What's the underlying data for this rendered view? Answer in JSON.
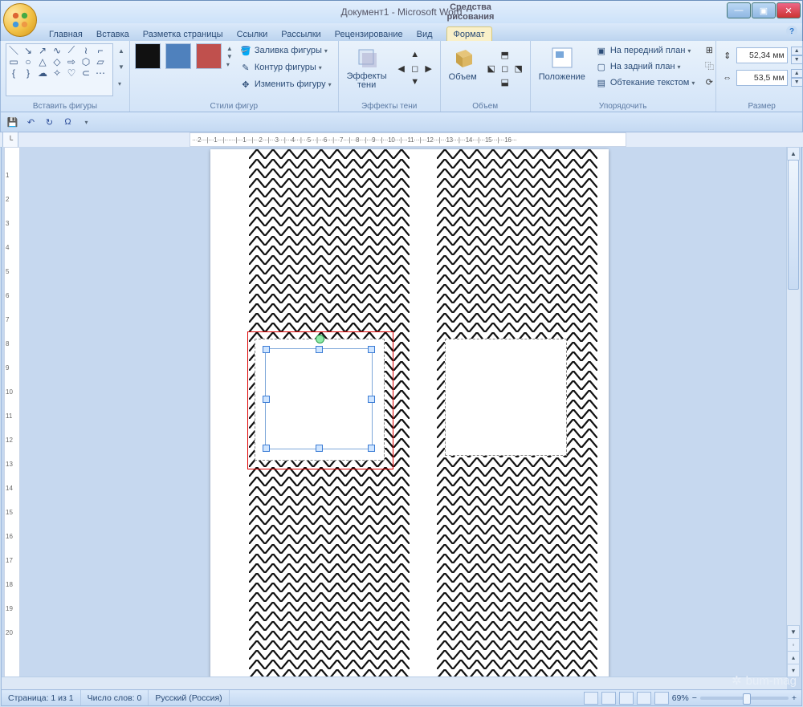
{
  "window": {
    "doc_title": "Документ1 - Microsoft Word",
    "tool_title": "Средства рисования"
  },
  "tabs": {
    "home": "Главная",
    "insert": "Вставка",
    "pagelayout": "Разметка страницы",
    "references": "Ссылки",
    "mailings": "Рассылки",
    "review": "Рецензирование",
    "view": "Вид",
    "format": "Формат"
  },
  "ribbon": {
    "insert_shapes": "Вставить фигуры",
    "shape_styles": "Стили фигур",
    "fill": "Заливка фигуры",
    "outline": "Контур фигуры",
    "change": "Изменить фигуру",
    "shadow_effects": "Эффекты\nтени",
    "shadow_group": "Эффекты тени",
    "volume": "Объем",
    "volume_group": "Объем",
    "position": "Положение",
    "bring_front": "На передний план",
    "send_back": "На задний план",
    "text_wrap": "Обтекание текстом",
    "arrange": "Упорядочить",
    "size_group": "Размер",
    "height": "52,34 мм",
    "width": "53,5 мм"
  },
  "ruler_text": "···2···|···1···|······|···1···|···2···|···3···|···4···|···5···|···6···|···7···|···8···|···9···|···10···|···11···|···12···|···13···|···14···|···15···|···16···",
  "status": {
    "page": "Страница: 1 из 1",
    "words": "Число слов: 0",
    "lang": "Русский (Россия)",
    "zoom": "69%"
  },
  "watermark": "bum-mag"
}
